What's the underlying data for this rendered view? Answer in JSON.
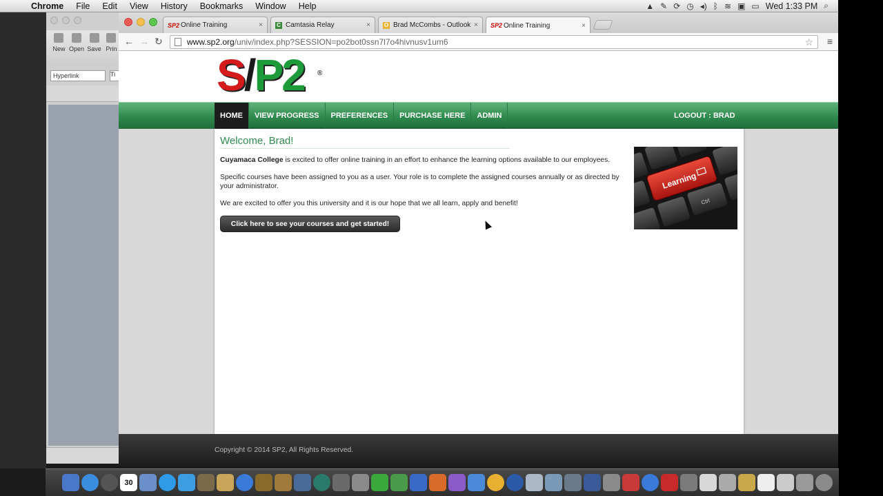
{
  "menubar": {
    "app": "Chrome",
    "items": [
      "File",
      "Edit",
      "View",
      "History",
      "Bookmarks",
      "Window",
      "Help"
    ],
    "clock": "Wed 1:33 PM"
  },
  "word": {
    "toolbar": [
      "New",
      "Open",
      "Save",
      "Prin"
    ],
    "style_box": "Hyperlink",
    "style_box2": "Ti"
  },
  "tabs": [
    {
      "favicon": "SP2",
      "title": "Online Training",
      "close": "×"
    },
    {
      "favicon": "C",
      "title": "Camtasia Relay",
      "close": "×"
    },
    {
      "favicon": "O",
      "title": "Brad McCombs - Outlook W",
      "close": "×"
    },
    {
      "favicon": "SP2",
      "title": "Online Training",
      "close": "×"
    }
  ],
  "address": {
    "host": "www.sp2.org",
    "path": "/univ/index.php?SESSION=po2bot0ssn7l7o4hivnusv1um6"
  },
  "logo": {
    "s": "S",
    "slash": "/",
    "p2": "P2",
    "reg": "®"
  },
  "nav": {
    "items": [
      "HOME",
      "VIEW PROGRESS",
      "PREFERENCES",
      "PURCHASE HERE",
      "ADMIN"
    ],
    "logout": "LOGOUT : BRAD"
  },
  "content": {
    "welcome": "Welcome, Brad!",
    "p1_bold": "Cuyamaca College",
    "p1_rest": " is excited to offer online training in an effort to enhance the learning options available to our employees.",
    "p2": "Specific courses have been assigned to you as a user. Your role is to complete the assigned courses annually or as directed by your administrator.",
    "p3": "We are excited to offer you this university and it is our hope that we all learn, apply and benefit!",
    "cta": "Click here to see your courses and get started!",
    "image_key": "Learning",
    "image_key2": "Ctrl"
  },
  "footer": {
    "copyright": "Copyright © 2014 SP2, All Rights Reserved."
  },
  "dock": {
    "calendar_day": "30"
  },
  "colors": {
    "brand_green": "#2e8a4d",
    "brand_red": "#d41a1a",
    "nav_dark": "#1d1d1d"
  }
}
